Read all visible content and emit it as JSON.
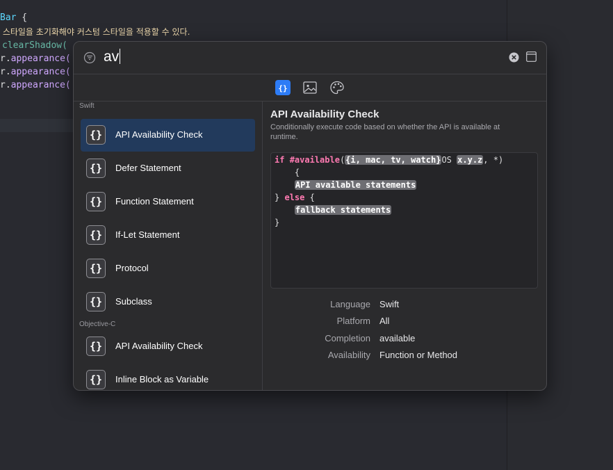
{
  "editor": {
    "line1_type": "Bar",
    "line1_brace": " {",
    "line2_comment": " 스타일을 초기화해야 커스텀 스타일을 적용할 수 있다.",
    "line3_fn": "clearShadow(",
    "line4_prefix": "r.",
    "line4_prop": "appearance(",
    "line5_prefix": "r.",
    "line5_prop": "appearance(",
    "line6_prefix": "r.",
    "line6_prop": "appearance("
  },
  "search": {
    "query": "av",
    "filter_icon": "filter-icon",
    "clear_icon": "clear-icon",
    "layout_icon": "sidebar-layout-icon"
  },
  "tabs": [
    {
      "name": "code-snippets",
      "icon": "braces-icon",
      "active": true
    },
    {
      "name": "media",
      "icon": "image-icon",
      "active": false
    },
    {
      "name": "colors",
      "icon": "palette-icon",
      "active": false
    }
  ],
  "library": {
    "sections": [
      {
        "title": "Swift"
      },
      {
        "title": "Objective-C"
      }
    ],
    "items": [
      {
        "label": "API Availability Check",
        "icon_glyph": "{}",
        "selected": true
      },
      {
        "label": "Defer Statement",
        "icon_glyph": "{}"
      },
      {
        "label": "Function Statement",
        "icon_glyph": "{}"
      },
      {
        "label": "If-Let Statement",
        "icon_glyph": "{}"
      },
      {
        "label": "Protocol",
        "icon_glyph": "{}"
      },
      {
        "label": "Subclass",
        "icon_glyph": "{}"
      },
      {
        "label": "API Availability Check",
        "icon_glyph": "{}"
      },
      {
        "label": "Inline Block as Variable",
        "icon_glyph": "{}"
      }
    ]
  },
  "detail": {
    "title": "API Availability Check",
    "description": "Conditionally execute code based on whether the API is available at runtime.",
    "code": {
      "kw_if": "if",
      "kw_available": "#available",
      "open_paren": "(",
      "platform_token": "{i, mac, tv, watch}",
      "os_text": "OS ",
      "version_token": "x.y.z",
      "rest": ", *)",
      "open_brace": "    {",
      "body_token": "API available statements",
      "close_brace": "} ",
      "kw_else": "else",
      "else_brace": " {",
      "fallback_token": "fallback statements",
      "final_brace": "}"
    },
    "meta": [
      {
        "key": "Language",
        "value": "Swift"
      },
      {
        "key": "Platform",
        "value": "All"
      },
      {
        "key": "Completion",
        "value": "available"
      },
      {
        "key": "Availability",
        "value": "Function or Method"
      }
    ]
  },
  "colors": {
    "accent": "#2d7cf6",
    "selection": "#223a5c",
    "keyword": "#ff7ab2",
    "placeholder_token": "#6e6e73"
  }
}
